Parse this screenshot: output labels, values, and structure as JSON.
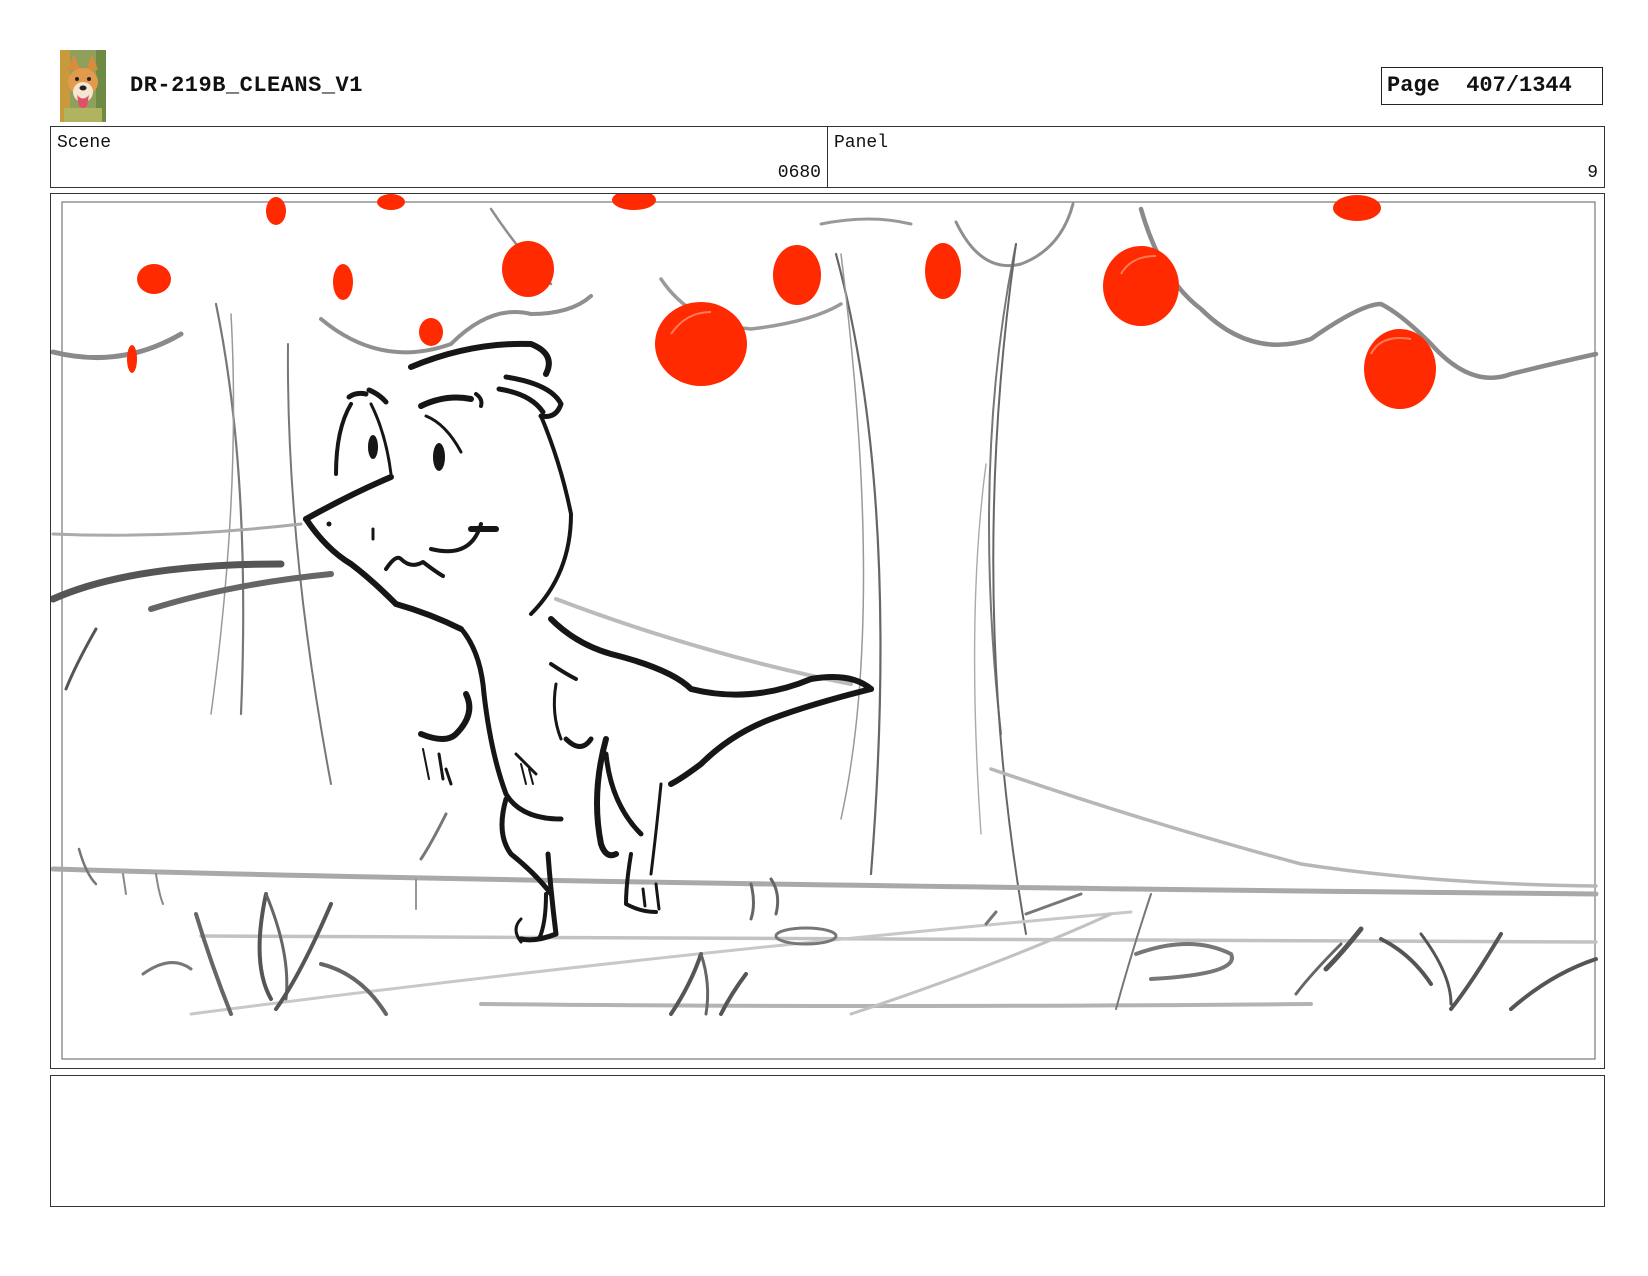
{
  "header": {
    "title": "DR-219B_CLEANS_V1",
    "page_label": "Page",
    "page_number": "407/1344"
  },
  "scene": {
    "label": "Scene",
    "value": "0680"
  },
  "panel": {
    "label": "Panel",
    "value": "9"
  },
  "notes": {
    "text": ""
  },
  "colors": {
    "apple": "#ff2a00",
    "sketch_dark": "#1a1a1a",
    "sketch_light": "#9a9a9a"
  },
  "icons": {
    "logo": "dog-avatar-icon"
  }
}
